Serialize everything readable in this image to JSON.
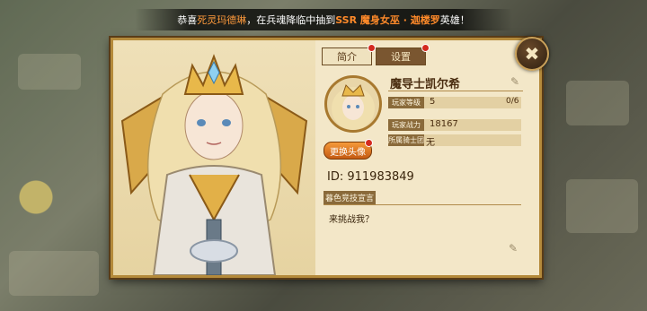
{
  "announcement": {
    "p1": "恭喜",
    "player": "死灵玛德琳",
    "p2": "，在兵魂降临中抽到",
    "ssr": "SSR 魔身女巫 · 迦楼罗",
    "p3": "英雄！"
  },
  "tabs": [
    {
      "label": "简介",
      "active": true
    },
    {
      "label": "设置",
      "active": false
    }
  ],
  "close_icon": "close-icon",
  "profile": {
    "name": "魔导士凯尔希",
    "level_label": "玩家等级",
    "level_value": "5",
    "level_progress": "0/6",
    "power_label": "玩家战力",
    "power_value": "18167",
    "guild_label": "所属骑士团",
    "guild_value": "无",
    "change_avatar": "更换头像",
    "id": "ID: 911983849",
    "declaration_tag": "暮色竞技宣言",
    "declaration_text": "来挑战我？"
  },
  "colors": {
    "panel": "#f3e7c8",
    "border": "#b48a3b",
    "label_bg": "#8a6a3a",
    "button": "#e07a24",
    "highlight": "#ff9a3c"
  }
}
